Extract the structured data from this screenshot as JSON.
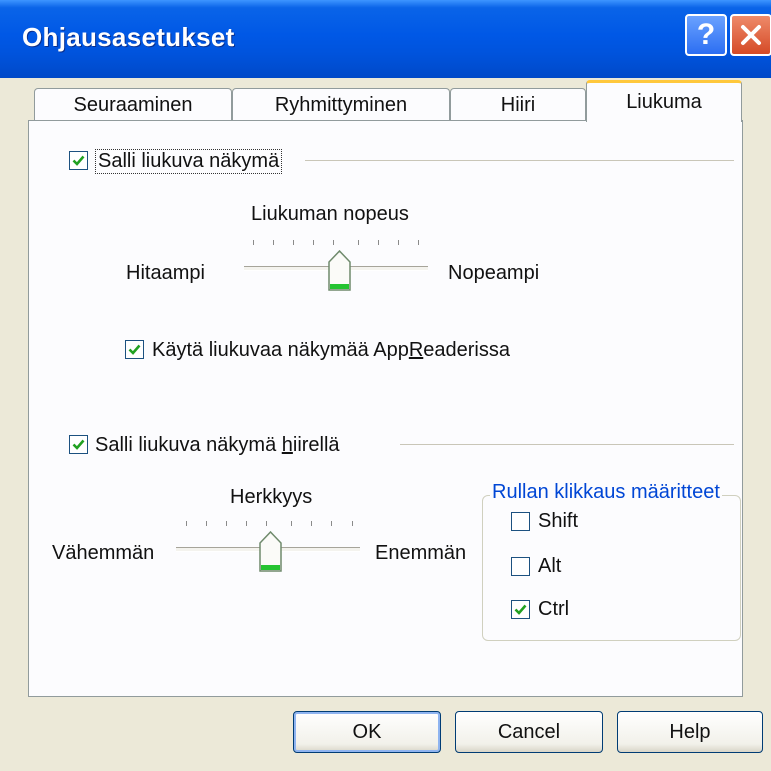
{
  "window": {
    "title": "Ohjausasetukset"
  },
  "titlebar": {
    "help_glyph": "?",
    "help_icon": "help-icon",
    "close_icon": "close-icon"
  },
  "tabs": [
    {
      "label": "Seuraaminen",
      "active": false
    },
    {
      "label": "Ryhmittyminen",
      "active": false
    },
    {
      "label": "Hiiri",
      "active": false
    },
    {
      "label": "Liukuma",
      "active": true
    }
  ],
  "scroll_section": {
    "enable_label": "Salli liukuva näkymä",
    "enable_checked": true,
    "speed_label": "Liukuman nopeus",
    "slow_label": "Hitaampi",
    "fast_label": "Nopeampi",
    "speed_level": 0.5,
    "appreader_label_pre": "Käytä liukuvaa näkymää App",
    "appreader_label_accel": "R",
    "appreader_label_post": "eaderissa",
    "appreader_checked": true
  },
  "mouse_section": {
    "enable_label_pre": "Salli liukuva näkymä ",
    "enable_label_accel": "h",
    "enable_label_post": "iirellä",
    "enable_checked": true,
    "sensitivity_label": "Herkkyys",
    "less_label": "Vähemmän",
    "more_label": "Enemmän",
    "sensitivity_level": 0.5,
    "modifiers_title": "Rullan klikkaus määritteet",
    "modifiers": [
      {
        "label": "Shift",
        "checked": false
      },
      {
        "label": "Alt",
        "checked": false
      },
      {
        "label": "Ctrl",
        "checked": true
      }
    ]
  },
  "buttons": {
    "ok": "OK",
    "cancel": "Cancel",
    "help": "Help"
  },
  "colors": {
    "titlebar": "#0058e6",
    "accent_tab": "#ffc83c",
    "group_title": "#0046d5",
    "check": "#21a121"
  }
}
